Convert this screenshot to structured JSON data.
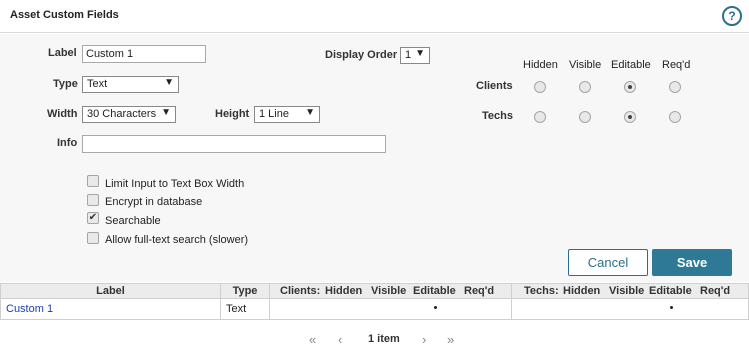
{
  "window": {
    "title": "Asset Custom Fields",
    "help_label": "?"
  },
  "form": {
    "label_label": "Label",
    "label_value": "Custom 1",
    "display_order_label": "Display Order",
    "display_order_value": "1",
    "type_label": "Type",
    "type_value": "Text",
    "width_label": "Width",
    "width_value": "30 Characters",
    "height_label": "Height",
    "height_value": "1 Line",
    "info_label": "Info",
    "info_value": ""
  },
  "permissions": {
    "columns": [
      "Hidden",
      "Visible",
      "Editable",
      "Req'd"
    ],
    "rows": [
      {
        "label": "Clients",
        "selected": "Editable"
      },
      {
        "label": "Techs",
        "selected": "Editable"
      }
    ]
  },
  "options": [
    {
      "label": "Limit Input to Text Box Width",
      "checked": false
    },
    {
      "label": "Encrypt in database",
      "checked": false
    },
    {
      "label": "Searchable",
      "checked": true
    },
    {
      "label": "Allow full-text search (slower)",
      "checked": false
    }
  ],
  "buttons": {
    "cancel": "Cancel",
    "save": "Save"
  },
  "table": {
    "headers": {
      "label": "Label",
      "type": "Type",
      "clients": "Clients:",
      "techs": "Techs:",
      "sub": [
        "Hidden",
        "Visible",
        "Editable",
        "Req'd"
      ]
    },
    "rows": [
      {
        "label": "Custom 1",
        "type": "Text",
        "clients_mark": "Editable",
        "techs_mark": "Editable"
      }
    ]
  },
  "pager": {
    "first": "«",
    "prev": "‹",
    "status": "1 item",
    "next": "›",
    "last": "»"
  },
  "colors": {
    "accent": "#2e7a96",
    "link": "#1a3fb0"
  }
}
